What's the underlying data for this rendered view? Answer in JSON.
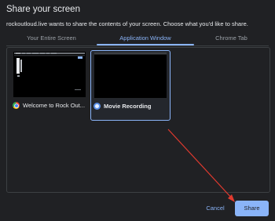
{
  "dialog": {
    "title": "Share your screen",
    "subtitle": "rockoutloud.live wants to share the contents of your screen. Choose what you'd like to share."
  },
  "tabs": [
    {
      "label": "Your Entire Screen",
      "active": false
    },
    {
      "label": "Application Window",
      "active": true
    },
    {
      "label": "Chrome Tab",
      "active": false
    }
  ],
  "windows": [
    {
      "label": "Welcome to Rock Out...",
      "icon": "chrome-icon",
      "selected": false
    },
    {
      "label": "Movie Recording",
      "icon": "movie-recording-icon",
      "selected": true
    }
  ],
  "buttons": {
    "cancel": "Cancel",
    "share": "Share"
  },
  "colors": {
    "accent": "#8ab4f8",
    "background": "#202124",
    "annotation_arrow": "#e03a2f"
  }
}
